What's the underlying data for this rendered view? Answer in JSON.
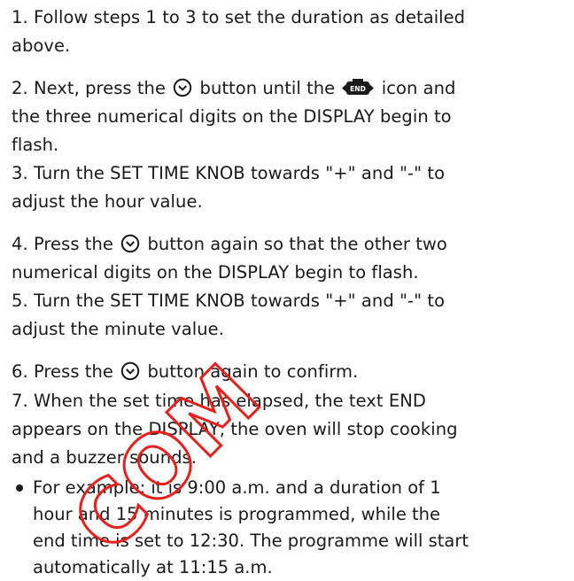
{
  "instructions": {
    "step1": {
      "line1": "1. Follow steps 1 to 3 to set the duration as detailed",
      "line2": "above."
    },
    "step2": {
      "line1_a": "2. Next, press the",
      "line1_b": "button until the",
      "line1_c": "icon and",
      "line2": "the three numerical digits on the DISPLAY begin to",
      "line3": "flash."
    },
    "step3": {
      "line1": "3. Turn the SET TIME KNOB towards  \"+\" and \"-\"  to",
      "line2": "adjust the hour value."
    },
    "step4": {
      "line1_a": "4. Press the",
      "line1_b": "button again so that the other two",
      "line2": "numerical digits on the DISPLAY begin to flash."
    },
    "step5": {
      "line1": "5. Turn the SET TIME KNOB towards  \"+\" and \"-\"  to",
      "line2": "adjust the minute value."
    },
    "step6": {
      "line1_a": "6. Press the",
      "line1_b": "button again to confirm."
    },
    "step7": {
      "line1": "7. When the set time has elapsed, the text END",
      "line2": "appears on the DISPLAY, the oven will stop cooking",
      "line3": "and a buzzer sounds."
    },
    "example": {
      "line1": "For example: it is 9:00 a.m. and a duration of 1",
      "line2": "hour and 15 minutes is programmed, while the",
      "line3": "end time is set to 12:30. The programme will start",
      "line4": "automatically at 11:15 a.m."
    }
  },
  "icons": {
    "clock_button": "clock-icon",
    "end_indicator": "end-icon",
    "end_indicator_text": "END"
  },
  "watermark": {
    "text": "COM",
    "color": "#e8201c"
  }
}
